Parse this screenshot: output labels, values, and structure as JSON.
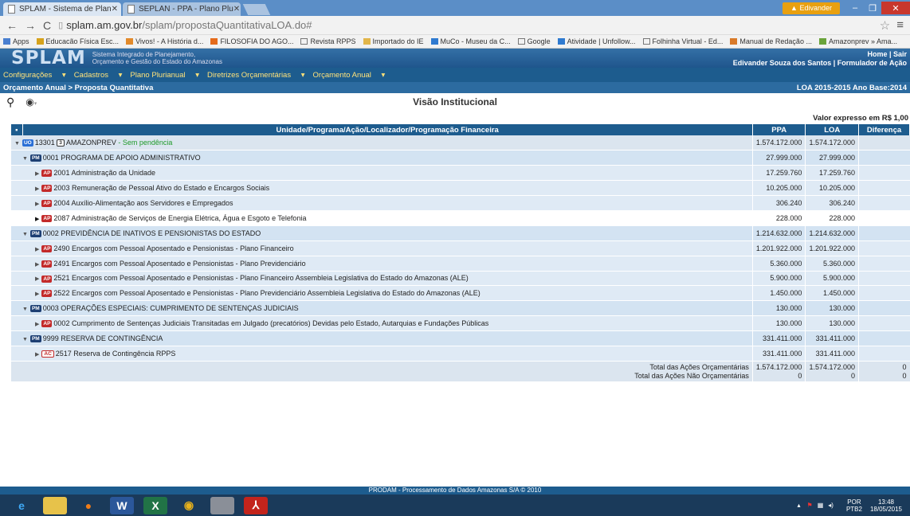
{
  "browser": {
    "tabs": [
      {
        "label": "SPLAM - Sistema de Plan"
      },
      {
        "label": "SEPLAN - PPA - Plano Plu"
      }
    ],
    "user_badge": "Edivander",
    "url_host": "splam.am.gov.br",
    "url_path": "/splam/propostaQuantitativaLOA.do#",
    "bookmarks": [
      "Apps",
      "Educacão Física Esc...",
      "Vivos! - A História d...",
      "FILOSOFIA DO AGO...",
      "Revista RPPS",
      "Importado do IE",
      "MuCo - Museu da C...",
      "Google",
      "Atividade | Unfollow...",
      "Folhinha Virtual - Ed...",
      "Manual de Redação ...",
      "Amazonprev » Ama..."
    ]
  },
  "app": {
    "logo": "SPLAM",
    "subtitle1": "Sistema Integrado de Planejamento,",
    "subtitle2": "Orçamento e Gestão do Estado do Amazonas",
    "home_sair": "Home | Sair",
    "user_line": "Edivander Souza dos Santos | Formulador de Ação",
    "menu": [
      "Configurações",
      "Cadastros",
      "Plano Plurianual",
      "Diretrizes Orçamentárias",
      "Orçamento Anual"
    ],
    "breadcrumb": "Orçamento Anual > Proposta Quantitativa",
    "loa_info": "LOA 2015-2015 Ano Base:2014",
    "view_title": "Visão Institucional",
    "valor_expresso": "Valor expresso em R$ 1,00"
  },
  "table": {
    "headers": [
      "Unidade/Programa/Ação/Localizador/Programação Financeira",
      "PPA",
      "LOA",
      "Diferença"
    ],
    "rows": [
      {
        "badge": "UO",
        "text": "13301",
        "extra": "3",
        "label": "AMAZONPREV",
        "status": "- Sem pendência",
        "ppa": "1.574.172.000",
        "loa": "1.574.172.000"
      },
      {
        "badge": "PM",
        "text": "0001 PROGRAMA DE APOIO ADMINISTRATIVO",
        "ppa": "27.999.000",
        "loa": "27.999.000"
      },
      {
        "badge": "AP",
        "text": "2001 Administração da Unidade",
        "ppa": "17.259.760",
        "loa": "17.259.760"
      },
      {
        "badge": "AP",
        "text": "2003 Remuneração de Pessoal Ativo do Estado e Encargos Sociais",
        "ppa": "10.205.000",
        "loa": "10.205.000"
      },
      {
        "badge": "AP",
        "text": "2004 Auxílio-Alimentação aos Servidores e Empregados",
        "ppa": "306.240",
        "loa": "306.240"
      },
      {
        "badge": "AP",
        "text": "2087 Administração de Serviços de Energia Elétrica, Água e Esgoto e Telefonia",
        "ppa": "228.000",
        "loa": "228.000"
      },
      {
        "badge": "PM",
        "text": "0002 PREVIDÊNCIA DE INATIVOS E PENSIONISTAS DO ESTADO",
        "ppa": "1.214.632.000",
        "loa": "1.214.632.000"
      },
      {
        "badge": "AP",
        "text": "2490 Encargos com Pessoal Aposentado e Pensionistas - Plano Financeiro",
        "ppa": "1.201.922.000",
        "loa": "1.201.922.000"
      },
      {
        "badge": "AP",
        "text": "2491 Encargos com Pessoal Aposentado e Pensionistas - Plano Previdenciário",
        "ppa": "5.360.000",
        "loa": "5.360.000"
      },
      {
        "badge": "AP",
        "text": "2521 Encargos com Pessoal Aposentado e Pensionistas - Plano Financeiro Assembleia Legislativa do Estado do Amazonas (ALE)",
        "ppa": "5.900.000",
        "loa": "5.900.000"
      },
      {
        "badge": "AP",
        "text": "2522 Encargos com Pessoal Aposentado e Pensionistas - Plano Previdenciário Assembleia Legislativa do Estado do Amazonas (ALE)",
        "ppa": "1.450.000",
        "loa": "1.450.000"
      },
      {
        "badge": "PM",
        "text": "0003 OPERAÇÕES ESPECIAIS: CUMPRIMENTO DE SENTENÇAS JUDICIAIS",
        "ppa": "130.000",
        "loa": "130.000"
      },
      {
        "badge": "AP",
        "text": "0002 Cumprimento de Sentenças Judiciais Transitadas em Julgado (precatórios) Devidas pelo Estado, Autarquias e Fundações Públicas",
        "ppa": "130.000",
        "loa": "130.000"
      },
      {
        "badge": "PM",
        "text": "9999 RESERVA DE CONTINGÊNCIA",
        "ppa": "331.411.000",
        "loa": "331.411.000"
      },
      {
        "badge": "AC",
        "text": "2517 Reserva de Contingência RPPS",
        "ppa": "331.411.000",
        "loa": "331.411.000"
      }
    ],
    "totals": {
      "label1": "Total das Ações Orçamentárias",
      "ppa1": "1.574.172.000",
      "loa1": "1.574.172.000",
      "dif1": "0",
      "label2": "Total das Ações Não Orçamentárias",
      "ppa2": "0",
      "loa2": "0",
      "dif2": "0"
    }
  },
  "footer": {
    "text": "PRODAM - Processamento de Dados Amazonas S/A © 2010"
  },
  "taskbar": {
    "lang": "POR",
    "layout": "PTB2",
    "time": "13:48",
    "date": "18/05/2015"
  }
}
